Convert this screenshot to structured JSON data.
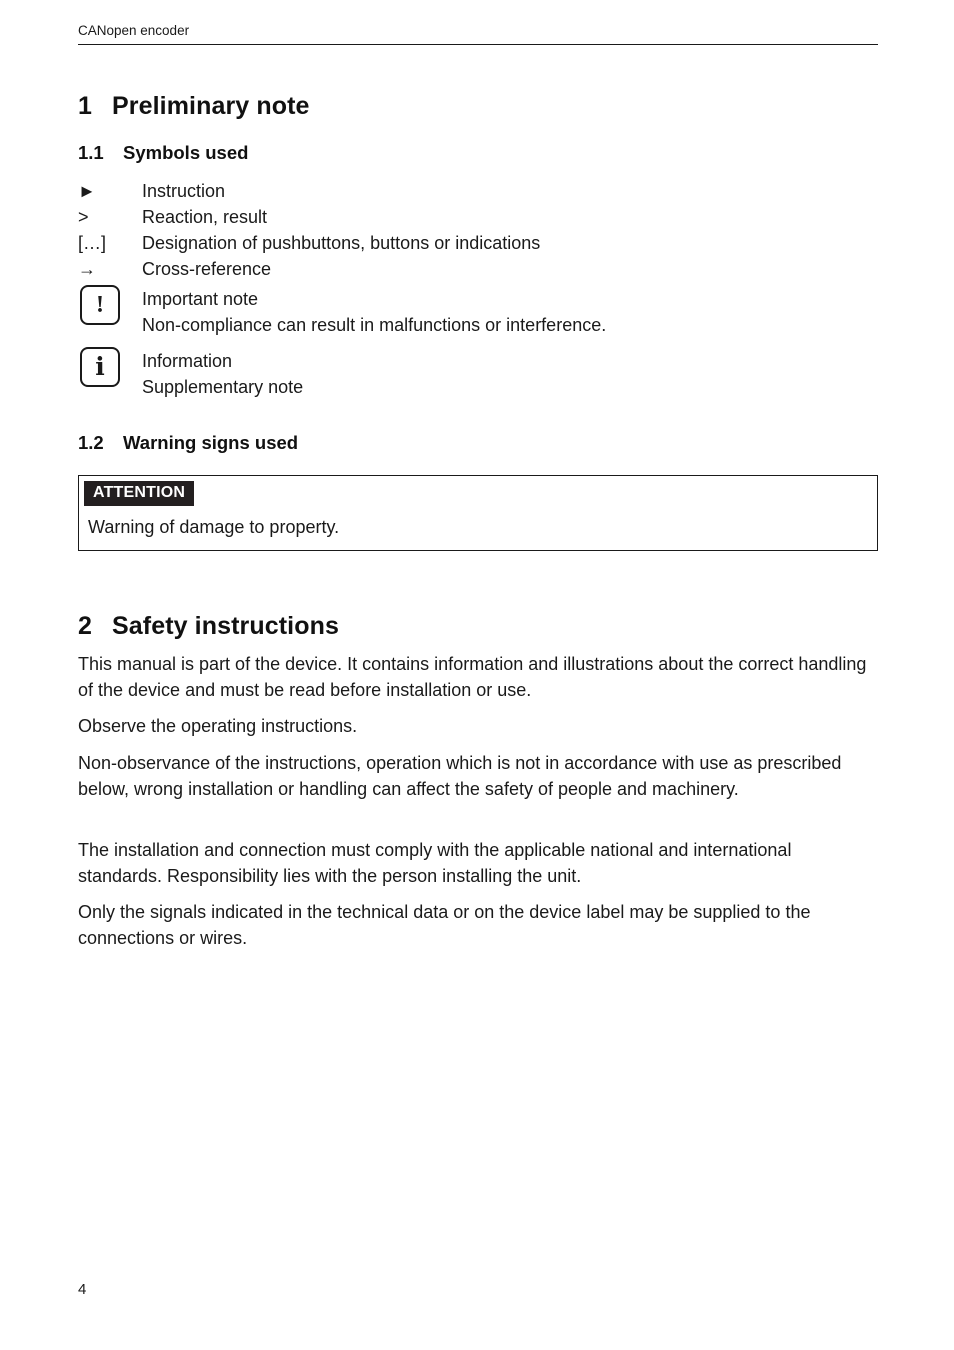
{
  "header": {
    "running_head": "CANopen encoder"
  },
  "section1": {
    "number": "1",
    "title": "Preliminary note",
    "sub1": {
      "number": "1.1",
      "title": "Symbols used",
      "rows": [
        {
          "key": "►",
          "key_name": "arrow-right-symbol",
          "value": "Instruction"
        },
        {
          "key": ">",
          "key_name": "greater-than-symbol",
          "value": "Reaction, result"
        },
        {
          "key": "[…]",
          "key_name": "square-brackets-symbol",
          "value": "Designation of pushbuttons, buttons or indications"
        },
        {
          "key": "→",
          "key_name": "cross-reference-arrow-symbol",
          "value": "Cross-reference"
        }
      ],
      "important_note": {
        "icon": "exclamation-mark-icon",
        "line1": "Important note",
        "line2": "Non-compliance can result in malfunctions or interference."
      },
      "information": {
        "icon": "information-icon",
        "line1": "Information",
        "line2": "Supplementary note"
      }
    },
    "sub2": {
      "number": "1.2",
      "title": "Warning signs used",
      "warning": {
        "label": "ATTENTION",
        "text": "Warning of damage to property."
      }
    }
  },
  "section2": {
    "number": "2",
    "title": "Safety instructions",
    "paragraphs": [
      "This manual is part of the device. It contains information and illustrations about the correct handling of the device and must be read before installation or use.",
      "Observe the operating instructions.",
      "Non-observance of the instructions, operation which is not in accordance with use as prescribed below, wrong installation or handling can affect the safety of people and machinery.",
      "The installation and connection must comply with the applicable national and international standards. Responsibility lies with the person installing the unit.",
      "Only the signals indicated in the technical data or on the device label may be supplied to the connections or wires."
    ]
  },
  "footer": {
    "page_number": "4"
  }
}
